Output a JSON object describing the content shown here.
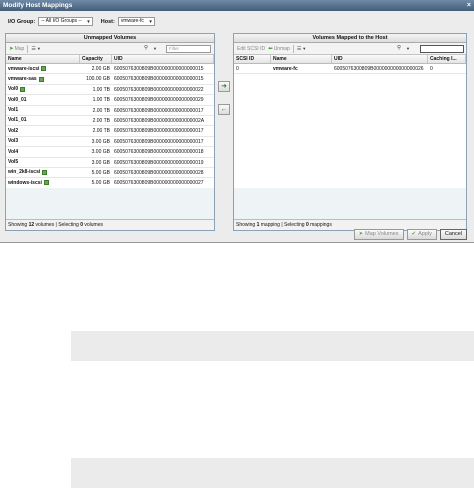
{
  "window": {
    "title": "Modify Host Mappings",
    "close": "×"
  },
  "filters": {
    "io_group_label": "I/O Group:",
    "io_group_value": "-- All I/O Groups --",
    "host_label": "Host:",
    "host_value": "vmware-fc"
  },
  "left_panel": {
    "title": "Unmapped Volumes",
    "toolbar": {
      "map_label": "Map",
      "filter_placeholder": "Filter"
    },
    "columns": [
      "Name",
      "Capacity",
      "UID"
    ],
    "rows": [
      {
        "name": "vmware-iscsi",
        "capacity": "2.00 GB",
        "uid": "6005076300809B000000000000000015",
        "icon": true
      },
      {
        "name": "vmware-sas",
        "capacity": "100.00 GB",
        "uid": "6005076300809B000000000000000015",
        "icon": true
      },
      {
        "name": "Vol0",
        "capacity": "1.00 TB",
        "uid": "6005076300809B000000000000000022",
        "icon": true
      },
      {
        "name": "Vol0_01",
        "capacity": "1.00 TB",
        "uid": "6005076300809B000000000000000029",
        "icon": false
      },
      {
        "name": "Vol1",
        "capacity": "2.00 TB",
        "uid": "6005076300809B000000000000000017",
        "icon": false
      },
      {
        "name": "Vol1_01",
        "capacity": "2.00 TB",
        "uid": "6005076300809B00000000000000002A",
        "icon": false
      },
      {
        "name": "Vol2",
        "capacity": "2.00 TB",
        "uid": "6005076300809B000000000000000017",
        "icon": false
      },
      {
        "name": "Vol3",
        "capacity": "3.00 GB",
        "uid": "6005076300809B000000000000000017",
        "icon": false
      },
      {
        "name": "Vol4",
        "capacity": "3.00 GB",
        "uid": "6005076300809B000000000000000018",
        "icon": false
      },
      {
        "name": "Vol5",
        "capacity": "3.00 GB",
        "uid": "6005076300809B000000000000000019",
        "icon": false
      },
      {
        "name": "win_2k8-iscsi",
        "capacity": "5.00 GB",
        "uid": "6005076300809B000000000000000028",
        "icon": true
      },
      {
        "name": "windows-iscsi",
        "capacity": "5.00 GB",
        "uid": "6005076300809B000000000000000027",
        "icon": true
      }
    ],
    "status": {
      "prefix": "Showing ",
      "count": "12",
      "mid": " volumes | Selecting ",
      "selected": "0",
      "suffix": " volumes"
    }
  },
  "right_panel": {
    "title": "Volumes Mapped to the Host",
    "toolbar": {
      "edit_label": "Edit SCSI ID",
      "unmap_label": "Unmap"
    },
    "columns": [
      "SCSI ID",
      "Name",
      "UID",
      "Caching I..."
    ],
    "rows": [
      {
        "scsi": "0",
        "name": "vmware-fc",
        "uid": "6005076300809B000000000000000026",
        "caching": "0"
      }
    ],
    "status": {
      "prefix": "Showing ",
      "count": "1",
      "mid": " mapping | Selecting ",
      "selected": "0",
      "suffix": " mappings"
    }
  },
  "transfer": {
    "add": "➜",
    "remove": "←"
  },
  "actions": {
    "map_volumes": "Map Volumes",
    "apply": "Apply",
    "cancel": "Cancel"
  }
}
